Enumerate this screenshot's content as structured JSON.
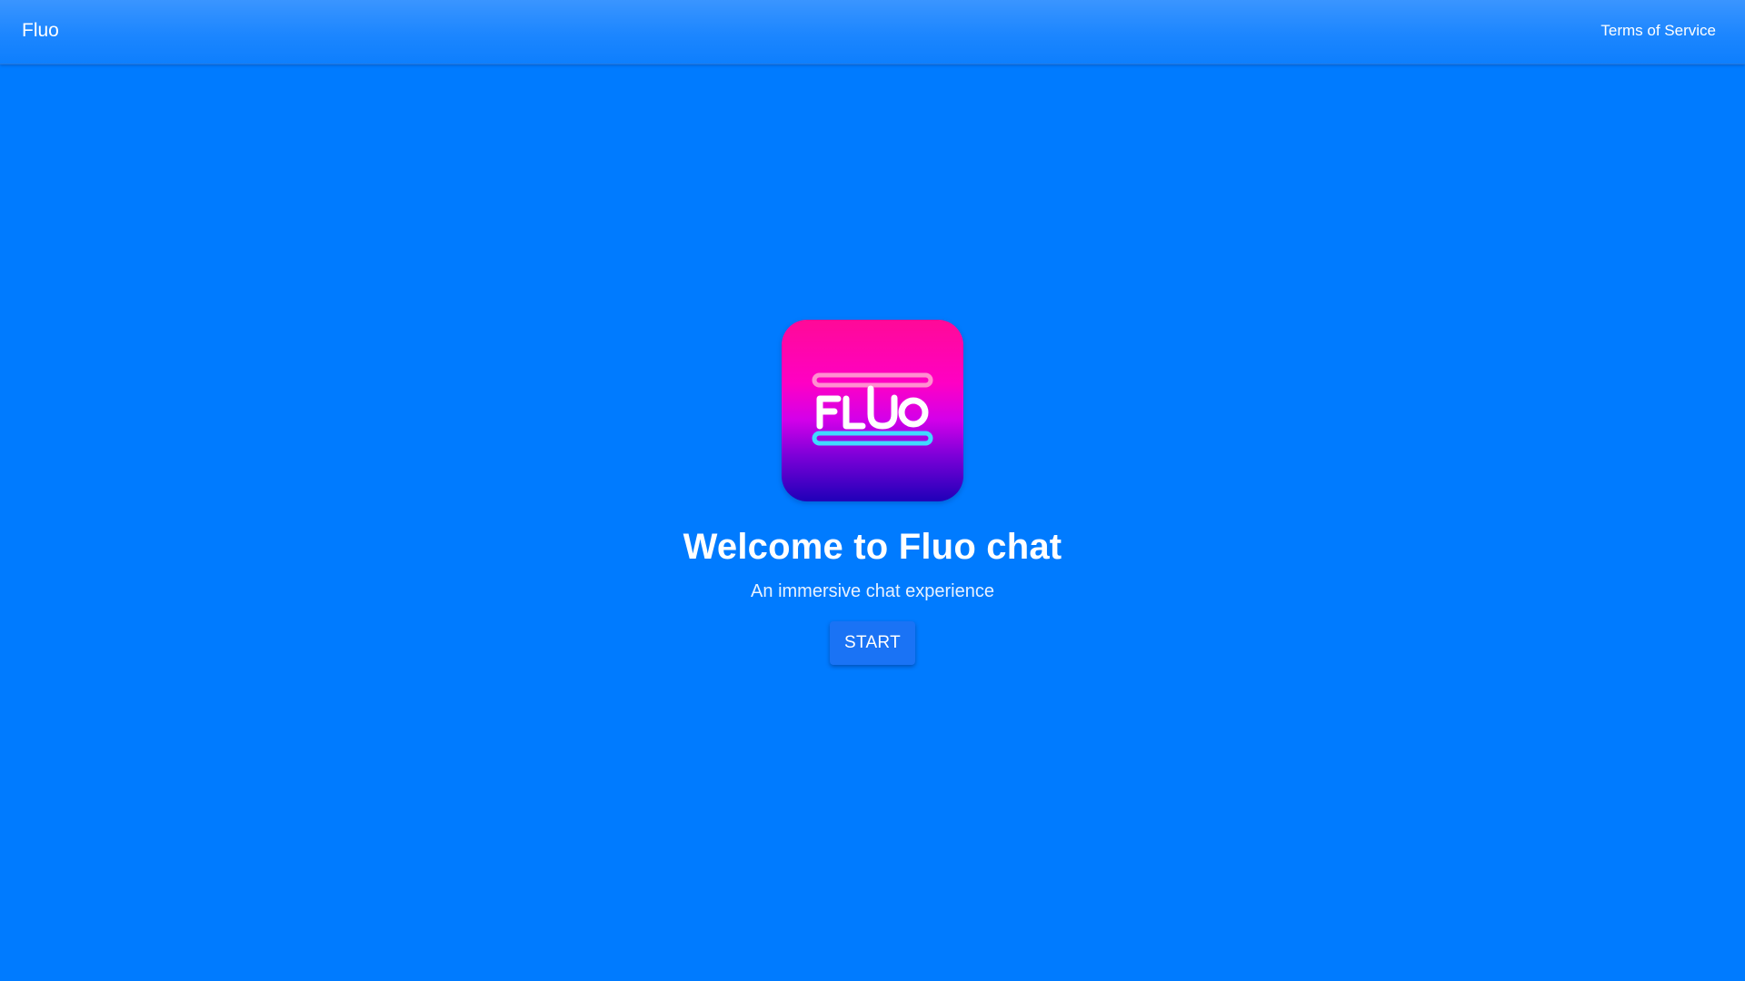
{
  "header": {
    "brand": "Fluo",
    "terms_link": "Terms of Service"
  },
  "hero": {
    "logo_text": "FLUO",
    "logo_icon": "fluo-neon-logo-icon",
    "title": "Welcome to Fluo chat",
    "subtitle": "An immersive chat experience",
    "start_label": "START"
  },
  "colors": {
    "background": "#007bff",
    "button": "#1a73f5",
    "logo_top": "#ff0a97",
    "logo_bottom": "#1f00b8",
    "neon_pink": "#ff7ac8",
    "neon_cyan": "#3ad6ff"
  }
}
